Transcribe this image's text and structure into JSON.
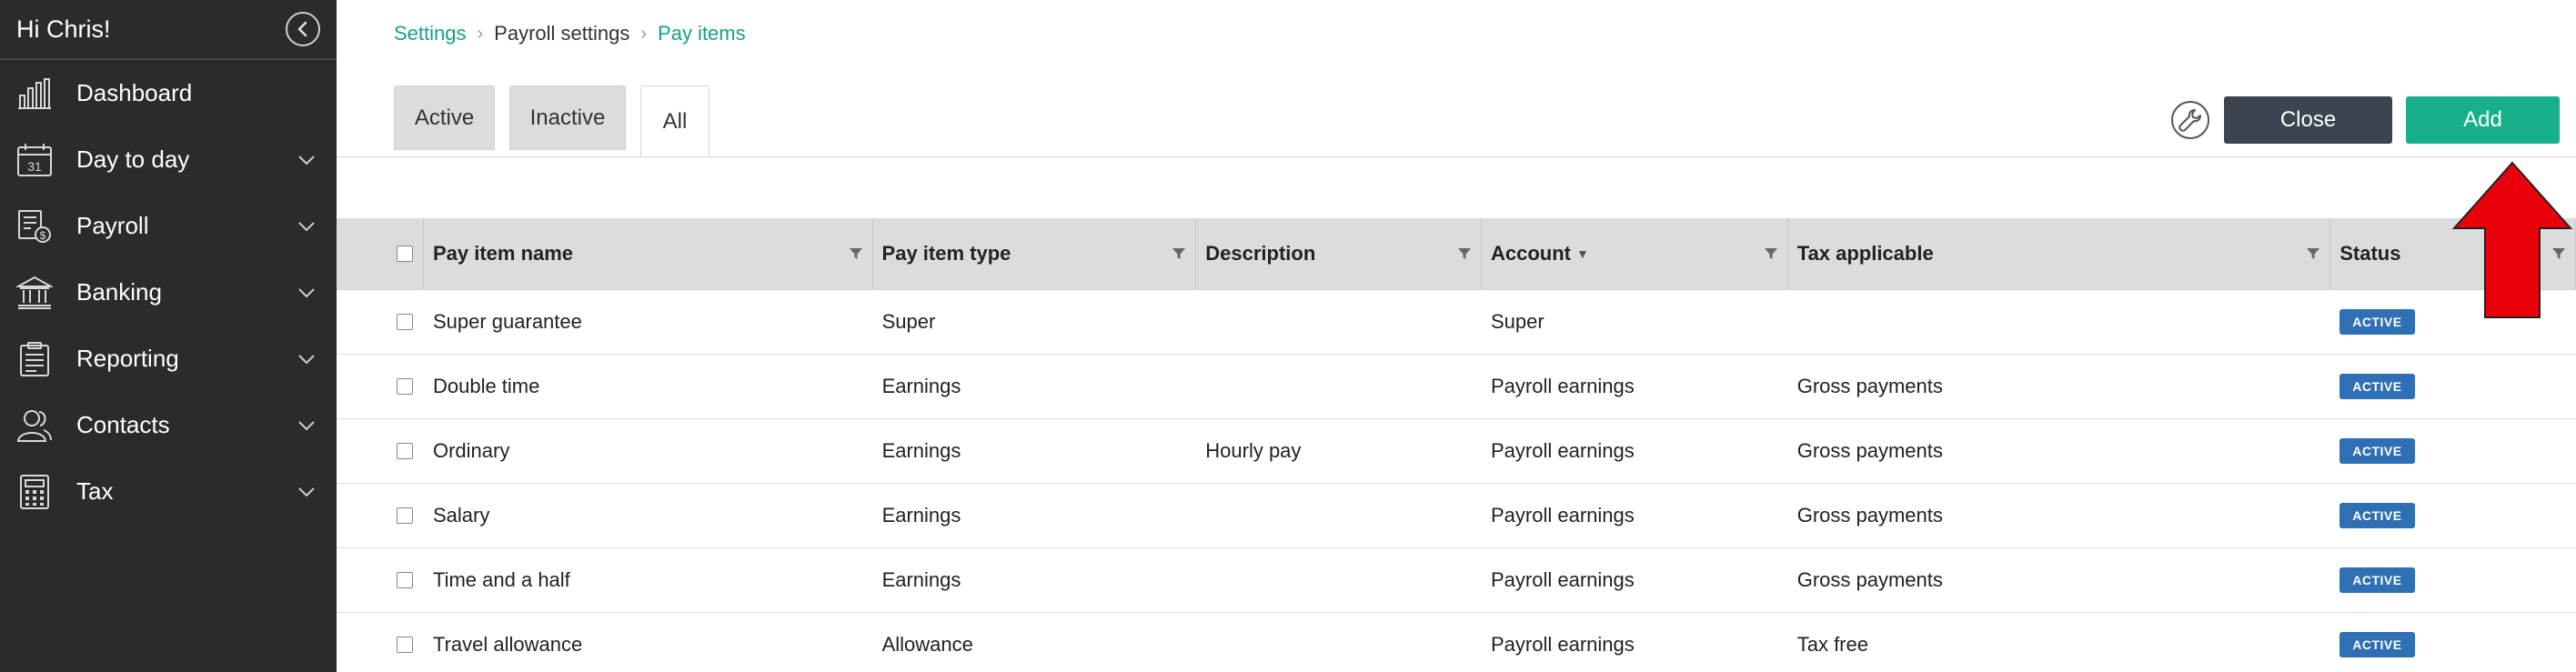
{
  "sidebar": {
    "greeting": "Hi Chris!",
    "items": [
      {
        "label": "Dashboard",
        "icon": "dashboard-icon",
        "has_chevron": false
      },
      {
        "label": "Day to day",
        "icon": "calendar-icon",
        "has_chevron": true
      },
      {
        "label": "Payroll",
        "icon": "payroll-icon",
        "has_chevron": true
      },
      {
        "label": "Banking",
        "icon": "bank-icon",
        "has_chevron": true
      },
      {
        "label": "Reporting",
        "icon": "clipboard-icon",
        "has_chevron": true
      },
      {
        "label": "Contacts",
        "icon": "contacts-icon",
        "has_chevron": true
      },
      {
        "label": "Tax",
        "icon": "calculator-icon",
        "has_chevron": true
      }
    ],
    "calendar_day": "31"
  },
  "breadcrumb": {
    "items": [
      "Settings",
      "Payroll settings",
      "Pay items"
    ]
  },
  "tabs": [
    {
      "label": "Active",
      "selected": false
    },
    {
      "label": "Inactive",
      "selected": false
    },
    {
      "label": "All",
      "selected": true
    }
  ],
  "toolbar": {
    "close_label": "Close",
    "add_label": "Add"
  },
  "table": {
    "columns": [
      "Pay item name",
      "Pay item type",
      "Description",
      "Account",
      "Tax applicable",
      "Status"
    ],
    "rows": [
      {
        "name": "Super guarantee",
        "type": "Super",
        "description": "",
        "account": "Super",
        "tax": "",
        "status": "ACTIVE"
      },
      {
        "name": "Double time",
        "type": "Earnings",
        "description": "",
        "account": "Payroll earnings",
        "tax": "Gross payments",
        "status": "ACTIVE"
      },
      {
        "name": "Ordinary",
        "type": "Earnings",
        "description": "Hourly pay",
        "account": "Payroll earnings",
        "tax": "Gross payments",
        "status": "ACTIVE"
      },
      {
        "name": "Salary",
        "type": "Earnings",
        "description": "",
        "account": "Payroll earnings",
        "tax": "Gross payments",
        "status": "ACTIVE"
      },
      {
        "name": "Time and a half",
        "type": "Earnings",
        "description": "",
        "account": "Payroll earnings",
        "tax": "Gross payments",
        "status": "ACTIVE"
      },
      {
        "name": "Travel allowance",
        "type": "Allowance",
        "description": "",
        "account": "Payroll earnings",
        "tax": "Tax free",
        "status": "ACTIVE"
      }
    ]
  },
  "colors": {
    "sidebar_bg": "#2b2b2b",
    "accent_green": "#17b08a",
    "link_green": "#16a085",
    "close_button": "#3b4450",
    "badge_blue": "#2f6fb3",
    "annotation_arrow": "#e8000b"
  }
}
